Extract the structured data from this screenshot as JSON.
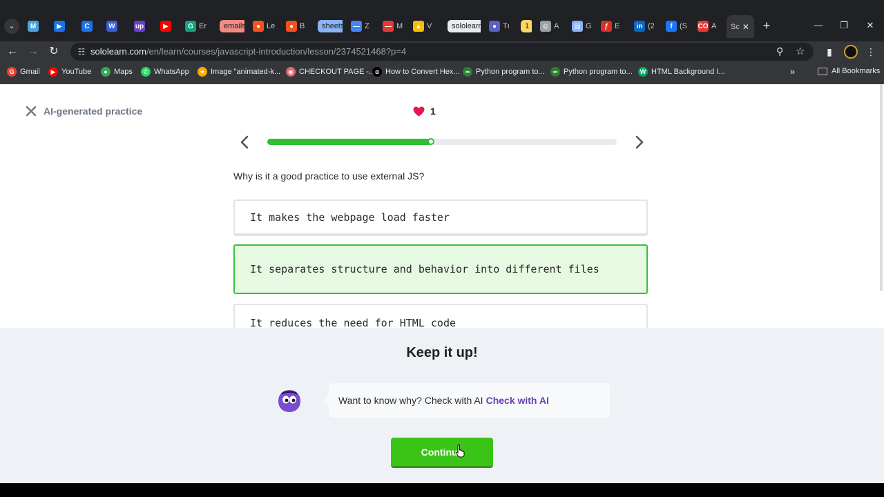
{
  "browser": {
    "tabs": [
      {
        "label": "M",
        "fav": "M",
        "color": "#4aa3df"
      },
      {
        "label": "",
        "fav": "▶",
        "color": "#1a73e8"
      },
      {
        "label": "",
        "fav": "C",
        "color": "#1a73e8"
      },
      {
        "label": "",
        "fav": "W",
        "color": "#3b5bdb"
      },
      {
        "label": "",
        "fav": "up",
        "color": "#6c3fc9"
      },
      {
        "label": "",
        "fav": "▶",
        "color": "#ff0000"
      },
      {
        "label": "Er",
        "fav": "G",
        "color": "#10a37f"
      },
      {
        "label": "emails",
        "pill": true,
        "color": "#f28b82"
      },
      {
        "label": "Le",
        "fav": "●",
        "color": "#f4511e"
      },
      {
        "label": "B",
        "fav": "●",
        "color": "#f4511e"
      },
      {
        "label": "sheets",
        "pill": true,
        "color": "#8ab4f8"
      },
      {
        "label": "Z",
        "fav": "—",
        "color": "#4285f4"
      },
      {
        "label": "M",
        "fav": "—",
        "color": "#e53935"
      },
      {
        "label": "V",
        "fav": "▲",
        "color": "#fbbc04"
      },
      {
        "label": "sololearn",
        "pill": true,
        "color": "#e8eaed"
      },
      {
        "label": "Tı",
        "fav": "●",
        "color": "#5b5fc7"
      },
      {
        "label": "1",
        "pill": true,
        "color": "#fdd663"
      },
      {
        "label": "A",
        "fav": "◎",
        "color": "#9aa0a6"
      },
      {
        "label": "G",
        "fav": "▤",
        "color": "#8ab4f8"
      },
      {
        "label": "E",
        "fav": "ƒ",
        "color": "#d93025"
      },
      {
        "label": "(2",
        "fav": "in",
        "color": "#0a66c2"
      },
      {
        "label": "(S",
        "fav": "f",
        "color": "#1877f2"
      },
      {
        "label": "A",
        "fav": "CO",
        "color": "#e53935"
      },
      {
        "label": "Sc",
        "active": true,
        "fav": "",
        "color": "#35363a"
      }
    ],
    "url_host": "sololearn.com",
    "url_path": "/en/learn/courses/javascript-introduction/lesson/2374521468?p=4",
    "bookmarks": [
      {
        "label": "Gmail",
        "fav": "G",
        "color": "#ea4335"
      },
      {
        "label": "YouTube",
        "fav": "▶",
        "color": "#ff0000"
      },
      {
        "label": "Maps",
        "fav": "●",
        "color": "#34a853"
      },
      {
        "label": "WhatsApp",
        "fav": "✆",
        "color": "#25d366"
      },
      {
        "label": "Image \"animated-k...",
        "fav": "★",
        "color": "#f9ab00"
      },
      {
        "label": "CHECKOUT PAGE -...",
        "fav": "◉",
        "color": "#e06666"
      },
      {
        "label": "How to Convert Hex...",
        "fav": "α",
        "color": "#000000"
      },
      {
        "label": "Python program to...",
        "fav": "∞",
        "color": "#2e7d32"
      },
      {
        "label": "Python program to...",
        "fav": "∞",
        "color": "#2e7d32"
      },
      {
        "label": "HTML Background I...",
        "fav": "W",
        "color": "#04aa6d"
      }
    ],
    "all_bookmarks": "All Bookmarks"
  },
  "lesson": {
    "title": "AI-generated practice",
    "hearts": "1",
    "progress": 0.47,
    "question": "Why is it a good practice to use external JS?",
    "options": [
      {
        "text": "It makes the webpage load faster",
        "selected": false
      },
      {
        "text": "It separates structure and behavior into different files",
        "selected": true
      },
      {
        "text": "It reduces the need for HTML code",
        "selected": false
      }
    ]
  },
  "feedback": {
    "title": "Keep it up!",
    "prompt": "Want to know why? Check with AI",
    "ai_link": "Check with AI",
    "continue_label": "Continue"
  },
  "colors": {
    "accent_green": "#3ac417",
    "progress_green": "#2fbf2f",
    "selected_bg": "#e6f9e1",
    "heart": "#e5174f",
    "ai_purple": "#6a3fb5"
  }
}
